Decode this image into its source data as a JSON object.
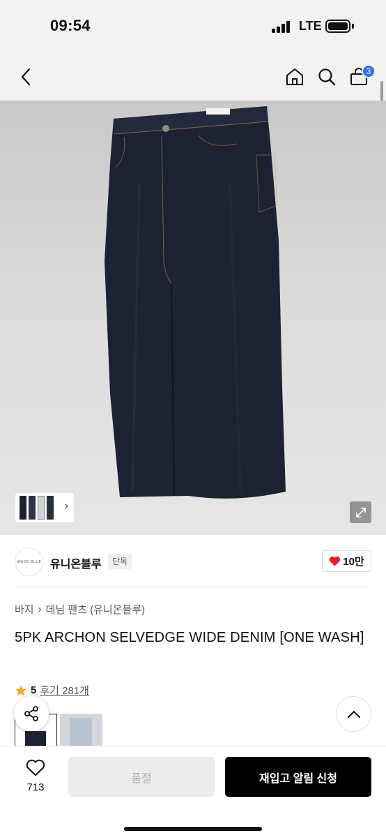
{
  "status_bar": {
    "time": "09:54",
    "network": "LTE",
    "icons": [
      "signal-icon",
      "battery-icon"
    ]
  },
  "nav": {
    "icons": [
      "back-icon",
      "home-icon",
      "search-icon",
      "cart-icon"
    ],
    "cart_count": "3"
  },
  "gallery": {
    "icons": [
      "thumbnail-chevron-icon",
      "expand-icon"
    ]
  },
  "brand": {
    "logo_text": "UNION BLUE",
    "name": "유니온블루",
    "tag": "단독",
    "likes": "10만",
    "heart_color": "#e8202a"
  },
  "breadcrumb": {
    "items": [
      "바지",
      "데님 팬츠 (유니온블루)"
    ]
  },
  "product": {
    "title": "5PK ARCHON SELVEDGE WIDE DENIM [ONE WASH]",
    "rating": "5",
    "reviews_link": "후기 281개",
    "star_color": "#f5a623"
  },
  "actions": {
    "wish_count": "713",
    "soldout_label": "품절",
    "restock_label": "재입고 알림 신청",
    "icons": [
      "share-icon",
      "scroll-top-icon",
      "heart-outline-icon"
    ]
  },
  "colors": {
    "accent_badge": "#2f6df6",
    "primary_button": "#000000",
    "denim": "#1d2233"
  }
}
